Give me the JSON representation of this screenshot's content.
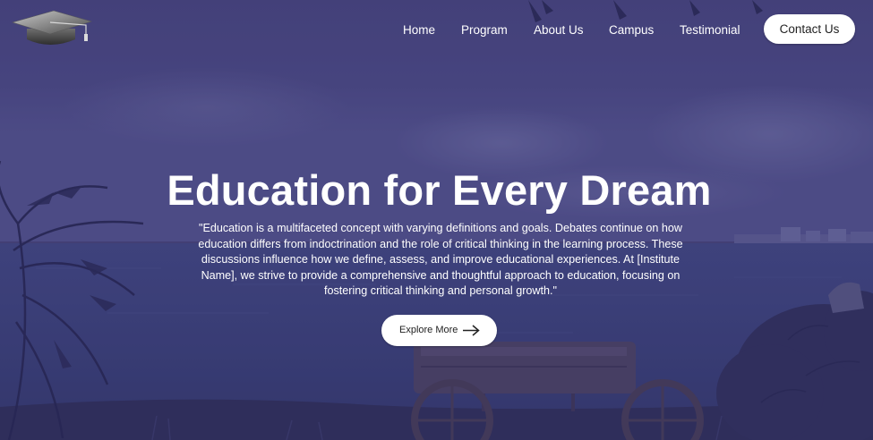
{
  "nav": {
    "items": [
      {
        "label": "Home"
      },
      {
        "label": "Program"
      },
      {
        "label": "About Us"
      },
      {
        "label": "Campus"
      },
      {
        "label": "Testimonial"
      }
    ],
    "contact_label": "Contact Us",
    "logo_icon": "graduation-cap-icon"
  },
  "hero": {
    "headline": "Education for Every Dream",
    "paragraph": "\"Education is a multifaceted concept with varying definitions and goals. Debates continue on how education differs from indoctrination and the role of critical thinking in the learning process. These discussions influence how we define, assess, and improve educational experiences. At [Institute Name], we strive to provide a comprehensive and thoughtful approach to education, focusing on fostering critical thinking and personal growth.\"",
    "explore_label": "Explore More",
    "explore_icon": "arrow-right-icon"
  },
  "colors": {
    "overlay": "#454173",
    "sea": "#3a3f7a",
    "text": "#ffffff",
    "button_bg": "#ffffff",
    "button_text": "#222222"
  }
}
